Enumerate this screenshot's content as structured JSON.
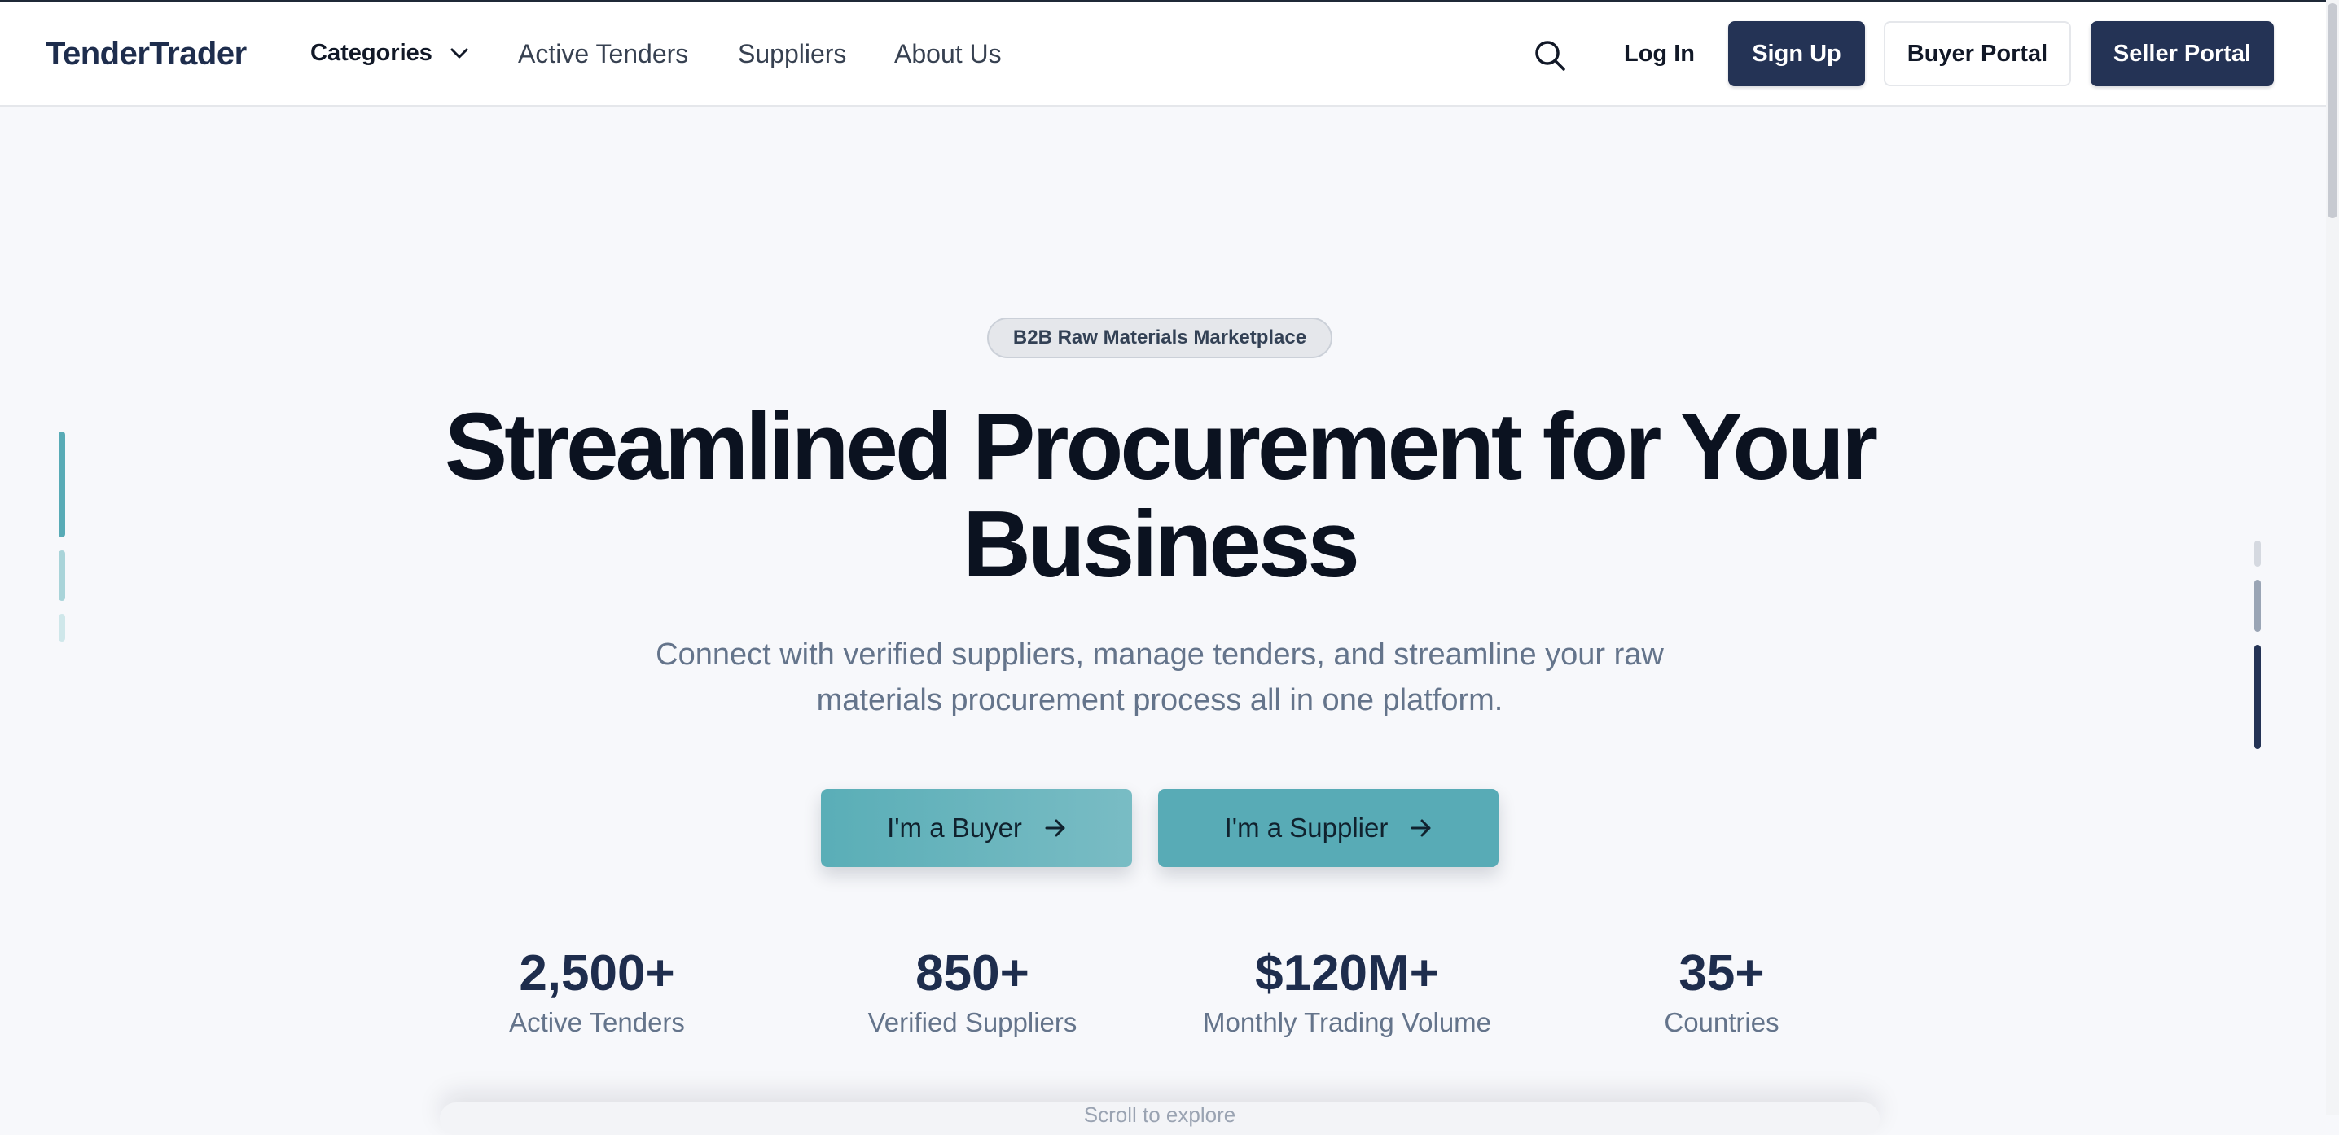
{
  "header": {
    "logo": "TenderTrader",
    "categories_label": "Categories",
    "links": [
      "Active Tenders",
      "Suppliers",
      "About Us"
    ],
    "login_label": "Log In",
    "signup_label": "Sign Up",
    "buyer_portal_label": "Buyer Portal",
    "seller_portal_label": "Seller Portal"
  },
  "hero": {
    "badge": "B2B Raw Materials Marketplace",
    "title_line1": "Streamlined Procurement for Your",
    "title_line2": "Business",
    "subtitle_line1": "Connect with verified suppliers, manage tenders, and streamline your raw",
    "subtitle_line2": "materials procurement process all in one platform.",
    "buyer_cta": "I'm a Buyer",
    "supplier_cta": "I'm a Supplier"
  },
  "stats": [
    {
      "value": "2,500+",
      "label": "Active Tenders"
    },
    {
      "value": "850+",
      "label": "Verified Suppliers"
    },
    {
      "value": "$120M+",
      "label": "Monthly Trading Volume"
    },
    {
      "value": "35+",
      "label": "Countries"
    }
  ],
  "scroll_hint": "Scroll to explore",
  "colors": {
    "brand_navy": "#243355",
    "accent_teal": "#58abb6",
    "text_dark": "#0b1220",
    "text_muted": "#64748b"
  },
  "icons": {
    "search": "search-icon",
    "categories_caret": "chevron-down-icon",
    "cta_arrow": "arrow-right-icon"
  }
}
